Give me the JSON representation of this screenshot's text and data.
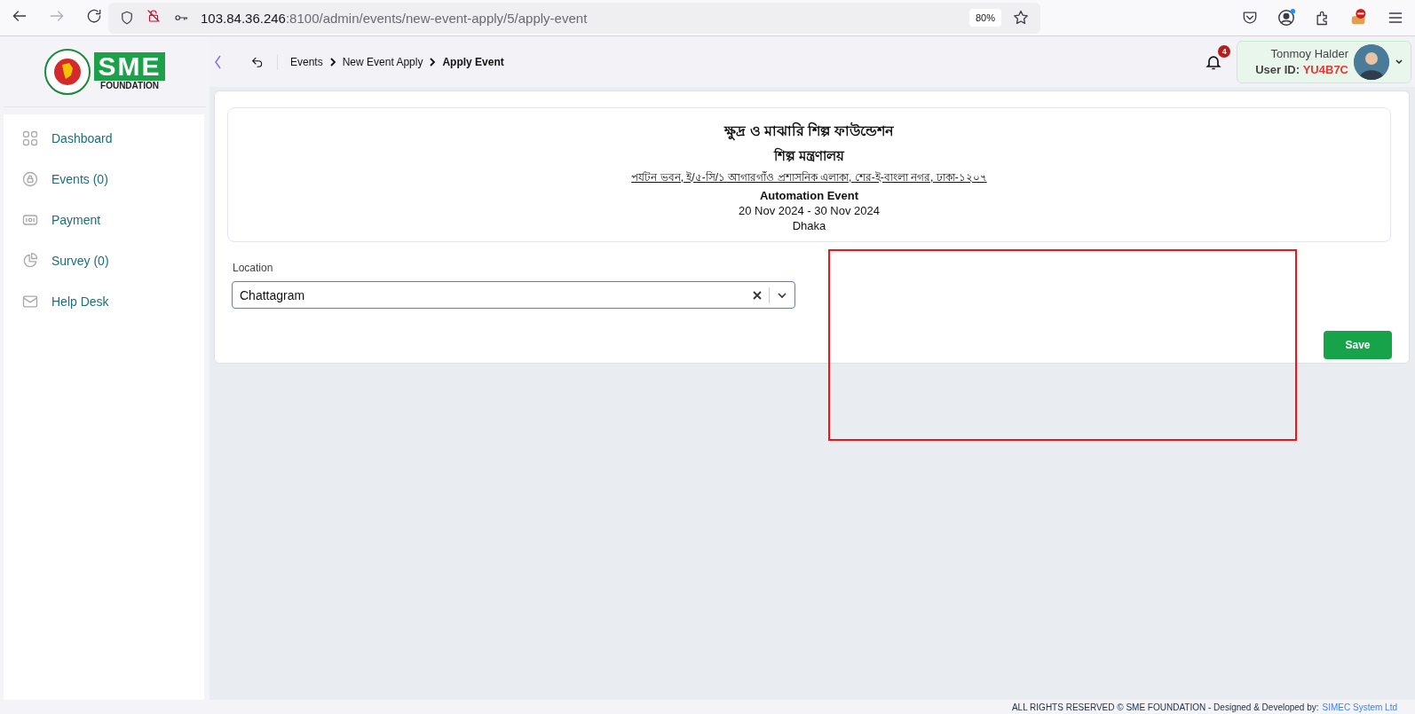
{
  "browser": {
    "url_host": "103.84.36.246",
    "url_path": ":8100/admin/events/new-event-apply/5/apply-event",
    "zoom": "80%"
  },
  "logo": {
    "wordmark": "SME",
    "subtitle": "FOUNDATION"
  },
  "sidebar": {
    "items": [
      {
        "label": "Dashboard"
      },
      {
        "label": "Events (0)"
      },
      {
        "label": "Payment"
      },
      {
        "label": "Survey (0)"
      },
      {
        "label": "Help Desk"
      }
    ]
  },
  "breadcrumb": [
    {
      "label": "Events",
      "current": false
    },
    {
      "label": "New Event Apply",
      "current": false
    },
    {
      "label": "Apply Event",
      "current": true
    }
  ],
  "notifications": {
    "count": "4"
  },
  "user": {
    "name": "Tonmoy Halder",
    "id_label": "User ID:",
    "id_value": "YU4B7C"
  },
  "event_card": {
    "org_name": "ক্ষুদ্র ও মাঝারি শিল্প ফাউন্ডেশন",
    "ministry": "শিল্প মন্ত্রণালয়",
    "address": "পর্যটন ভবন, ই/৫-সি/১ আগারগাঁও প্রশাসনিক এলাকা, শের-ই-বাংলা নগর, ঢাকা-১২০৭",
    "event_title": "Automation Event",
    "dates": "20 Nov 2024 - 30 Nov 2024",
    "venue": "Dhaka"
  },
  "form": {
    "location": {
      "label": "Location",
      "value": "Chattagram"
    }
  },
  "save_button": "Save",
  "footer": {
    "text": "ALL RIGHTS RESERVED © SME FOUNDATION - Designed & Developed by:",
    "link": "SIMEC System Ltd"
  }
}
